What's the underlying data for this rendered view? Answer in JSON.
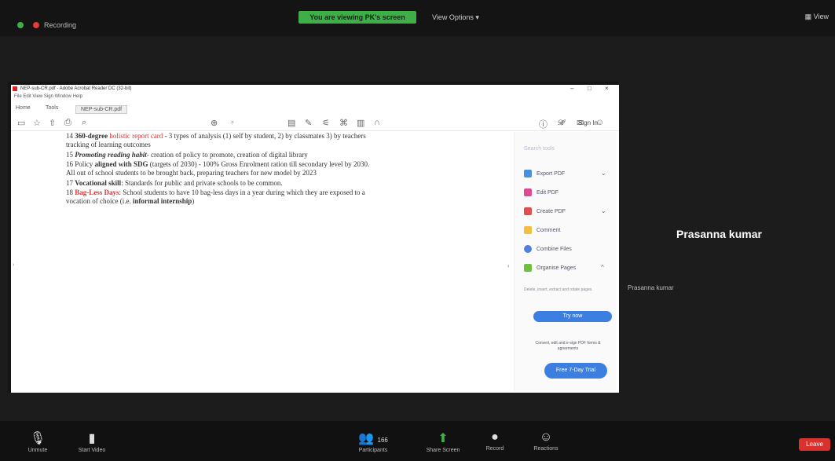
{
  "top": {
    "recording_label": "Recording",
    "viewing_banner": "You are viewing PK's screen",
    "view_options": "View Options ▾",
    "view_right": "View"
  },
  "acrobat": {
    "title": "NEP-sub-CR.pdf - Adobe Acrobat Reader DC (32-bit)",
    "menu": "File   Edit   View   Sign   Window   Help",
    "tabs": [
      "Home",
      "Tools",
      "NEP-sub-CR.pdf"
    ],
    "sign_in": "Sign In",
    "window_controls": [
      "–",
      "□",
      "×"
    ]
  },
  "doc": {
    "items": [
      {
        "num": "14",
        "bold": "360-degree",
        "red": " holistic report card",
        "rest": " - 3 types of analysis (1) self by student, 2) by classmates 3) by teachers",
        "line2": "tracking of learning outcomes"
      },
      {
        "num": "15",
        "bi": "Promoting reading habit",
        "rest": "- creation of policy to promote, creation of digital library"
      },
      {
        "num": "16",
        "pre": "Policy ",
        "bold": "aligned with SDG",
        "rest": " (targets of 2030) - 100% Gross Enrolment ration till secondary level by 2030.",
        "line2": "All out of school students to be brought back, preparing teachers for new model by 2023"
      },
      {
        "num": "17",
        "bold": "Vocational skill",
        "rest": ": Standards for public and private schools to be common."
      },
      {
        "num": "18",
        "redbold": "Bag-Less Days",
        "rest": ": School students to have 10 bag-less days in a year during which they are exposed to a",
        "line2_pre": "vocation of choice (i.e. ",
        "line2_bold": "informal internship",
        "line2_post": ")"
      }
    ]
  },
  "right_panel": {
    "search": "Search tools",
    "items": [
      "Export PDF",
      "Edit PDF",
      "Create PDF",
      "Comment",
      "Combine Files",
      "Organise Pages"
    ],
    "desc": "Delete, insert, extract and rotate pages.",
    "try_now": "Try now",
    "desc2": "Convert, edit and e-sign PDF forms & agreements",
    "free_trial": "Free 7-Day Trial"
  },
  "participant": {
    "name": "Prasanna kumar",
    "label": "Prasanna kumar"
  },
  "bottom": {
    "unmute": "Unmute",
    "start_video": "Start Video",
    "participants": "Participants",
    "participant_count": "166",
    "share_screen": "Share Screen",
    "record": "Record",
    "reactions": "Reactions",
    "leave": "Leave"
  }
}
